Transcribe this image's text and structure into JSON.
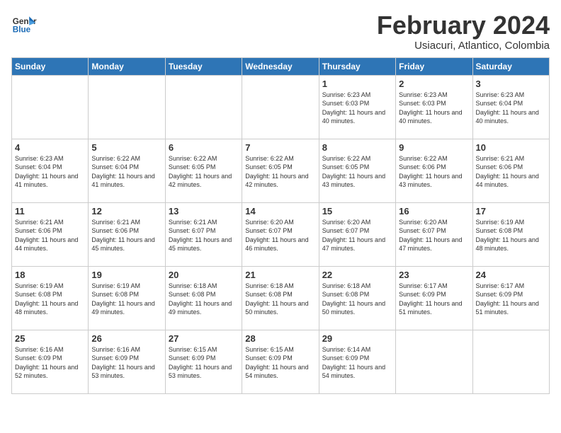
{
  "logo": {
    "general": "General",
    "blue": "Blue"
  },
  "title": "February 2024",
  "subtitle": "Usiacuri, Atlantico, Colombia",
  "days_of_week": [
    "Sunday",
    "Monday",
    "Tuesday",
    "Wednesday",
    "Thursday",
    "Friday",
    "Saturday"
  ],
  "weeks": [
    [
      {
        "day": "",
        "sunrise": "",
        "sunset": "",
        "daylight": ""
      },
      {
        "day": "",
        "sunrise": "",
        "sunset": "",
        "daylight": ""
      },
      {
        "day": "",
        "sunrise": "",
        "sunset": "",
        "daylight": ""
      },
      {
        "day": "",
        "sunrise": "",
        "sunset": "",
        "daylight": ""
      },
      {
        "day": "1",
        "sunrise": "Sunrise: 6:23 AM",
        "sunset": "Sunset: 6:03 PM",
        "daylight": "Daylight: 11 hours and 40 minutes."
      },
      {
        "day": "2",
        "sunrise": "Sunrise: 6:23 AM",
        "sunset": "Sunset: 6:03 PM",
        "daylight": "Daylight: 11 hours and 40 minutes."
      },
      {
        "day": "3",
        "sunrise": "Sunrise: 6:23 AM",
        "sunset": "Sunset: 6:04 PM",
        "daylight": "Daylight: 11 hours and 40 minutes."
      }
    ],
    [
      {
        "day": "4",
        "sunrise": "Sunrise: 6:23 AM",
        "sunset": "Sunset: 6:04 PM",
        "daylight": "Daylight: 11 hours and 41 minutes."
      },
      {
        "day": "5",
        "sunrise": "Sunrise: 6:22 AM",
        "sunset": "Sunset: 6:04 PM",
        "daylight": "Daylight: 11 hours and 41 minutes."
      },
      {
        "day": "6",
        "sunrise": "Sunrise: 6:22 AM",
        "sunset": "Sunset: 6:05 PM",
        "daylight": "Daylight: 11 hours and 42 minutes."
      },
      {
        "day": "7",
        "sunrise": "Sunrise: 6:22 AM",
        "sunset": "Sunset: 6:05 PM",
        "daylight": "Daylight: 11 hours and 42 minutes."
      },
      {
        "day": "8",
        "sunrise": "Sunrise: 6:22 AM",
        "sunset": "Sunset: 6:05 PM",
        "daylight": "Daylight: 11 hours and 43 minutes."
      },
      {
        "day": "9",
        "sunrise": "Sunrise: 6:22 AM",
        "sunset": "Sunset: 6:06 PM",
        "daylight": "Daylight: 11 hours and 43 minutes."
      },
      {
        "day": "10",
        "sunrise": "Sunrise: 6:21 AM",
        "sunset": "Sunset: 6:06 PM",
        "daylight": "Daylight: 11 hours and 44 minutes."
      }
    ],
    [
      {
        "day": "11",
        "sunrise": "Sunrise: 6:21 AM",
        "sunset": "Sunset: 6:06 PM",
        "daylight": "Daylight: 11 hours and 44 minutes."
      },
      {
        "day": "12",
        "sunrise": "Sunrise: 6:21 AM",
        "sunset": "Sunset: 6:06 PM",
        "daylight": "Daylight: 11 hours and 45 minutes."
      },
      {
        "day": "13",
        "sunrise": "Sunrise: 6:21 AM",
        "sunset": "Sunset: 6:07 PM",
        "daylight": "Daylight: 11 hours and 45 minutes."
      },
      {
        "day": "14",
        "sunrise": "Sunrise: 6:20 AM",
        "sunset": "Sunset: 6:07 PM",
        "daylight": "Daylight: 11 hours and 46 minutes."
      },
      {
        "day": "15",
        "sunrise": "Sunrise: 6:20 AM",
        "sunset": "Sunset: 6:07 PM",
        "daylight": "Daylight: 11 hours and 47 minutes."
      },
      {
        "day": "16",
        "sunrise": "Sunrise: 6:20 AM",
        "sunset": "Sunset: 6:07 PM",
        "daylight": "Daylight: 11 hours and 47 minutes."
      },
      {
        "day": "17",
        "sunrise": "Sunrise: 6:19 AM",
        "sunset": "Sunset: 6:08 PM",
        "daylight": "Daylight: 11 hours and 48 minutes."
      }
    ],
    [
      {
        "day": "18",
        "sunrise": "Sunrise: 6:19 AM",
        "sunset": "Sunset: 6:08 PM",
        "daylight": "Daylight: 11 hours and 48 minutes."
      },
      {
        "day": "19",
        "sunrise": "Sunrise: 6:19 AM",
        "sunset": "Sunset: 6:08 PM",
        "daylight": "Daylight: 11 hours and 49 minutes."
      },
      {
        "day": "20",
        "sunrise": "Sunrise: 6:18 AM",
        "sunset": "Sunset: 6:08 PM",
        "daylight": "Daylight: 11 hours and 49 minutes."
      },
      {
        "day": "21",
        "sunrise": "Sunrise: 6:18 AM",
        "sunset": "Sunset: 6:08 PM",
        "daylight": "Daylight: 11 hours and 50 minutes."
      },
      {
        "day": "22",
        "sunrise": "Sunrise: 6:18 AM",
        "sunset": "Sunset: 6:08 PM",
        "daylight": "Daylight: 11 hours and 50 minutes."
      },
      {
        "day": "23",
        "sunrise": "Sunrise: 6:17 AM",
        "sunset": "Sunset: 6:09 PM",
        "daylight": "Daylight: 11 hours and 51 minutes."
      },
      {
        "day": "24",
        "sunrise": "Sunrise: 6:17 AM",
        "sunset": "Sunset: 6:09 PM",
        "daylight": "Daylight: 11 hours and 51 minutes."
      }
    ],
    [
      {
        "day": "25",
        "sunrise": "Sunrise: 6:16 AM",
        "sunset": "Sunset: 6:09 PM",
        "daylight": "Daylight: 11 hours and 52 minutes."
      },
      {
        "day": "26",
        "sunrise": "Sunrise: 6:16 AM",
        "sunset": "Sunset: 6:09 PM",
        "daylight": "Daylight: 11 hours and 53 minutes."
      },
      {
        "day": "27",
        "sunrise": "Sunrise: 6:15 AM",
        "sunset": "Sunset: 6:09 PM",
        "daylight": "Daylight: 11 hours and 53 minutes."
      },
      {
        "day": "28",
        "sunrise": "Sunrise: 6:15 AM",
        "sunset": "Sunset: 6:09 PM",
        "daylight": "Daylight: 11 hours and 54 minutes."
      },
      {
        "day": "29",
        "sunrise": "Sunrise: 6:14 AM",
        "sunset": "Sunset: 6:09 PM",
        "daylight": "Daylight: 11 hours and 54 minutes."
      },
      {
        "day": "",
        "sunrise": "",
        "sunset": "",
        "daylight": ""
      },
      {
        "day": "",
        "sunrise": "",
        "sunset": "",
        "daylight": ""
      }
    ]
  ]
}
